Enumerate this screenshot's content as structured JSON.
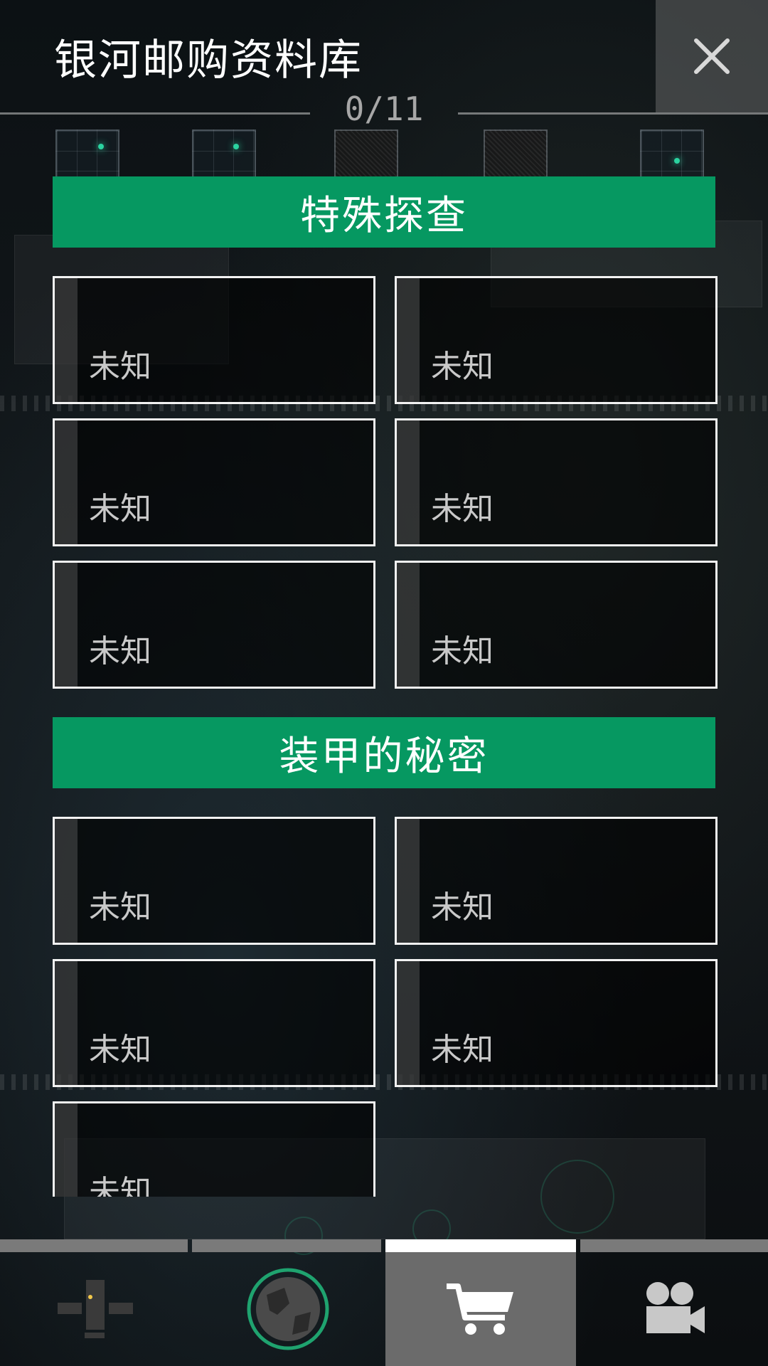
{
  "header": {
    "title": "银河邮购资料库",
    "progress": "0/11",
    "close_icon": "close-icon"
  },
  "thumbnails": [
    {
      "style": "grid",
      "has_dot": true
    },
    {
      "style": "grid",
      "has_dot": true
    },
    {
      "style": "noise",
      "has_dot": false
    },
    {
      "style": "noise",
      "has_dot": false
    },
    {
      "style": "grid",
      "has_dot": true
    }
  ],
  "sections": [
    {
      "title": "特殊探查",
      "items": [
        "未知",
        "未知",
        "未知",
        "未知",
        "未知",
        "未知"
      ]
    },
    {
      "title": "装甲的秘密",
      "items": [
        "未知",
        "未知",
        "未知",
        "未知",
        "未知"
      ]
    }
  ],
  "bottom_nav": {
    "active_index": 2,
    "tabs": [
      {
        "icon": "controller-icon"
      },
      {
        "icon": "planet-globe-icon"
      },
      {
        "icon": "shopping-cart-icon"
      },
      {
        "icon": "video-camera-icon"
      }
    ]
  },
  "colors": {
    "section_header": "#069861",
    "card_border": "#f2f2f2",
    "globe_ring": "#1fa36f"
  }
}
